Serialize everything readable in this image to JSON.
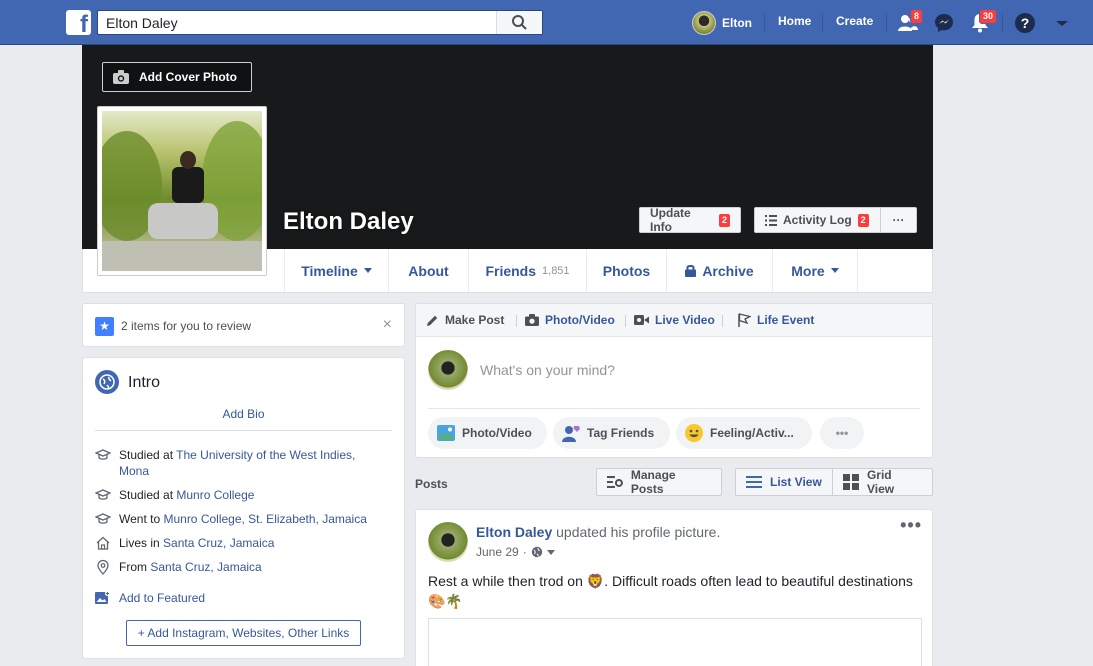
{
  "topbar": {
    "logo": "f",
    "search_value": "Elton Daley",
    "search_placeholder": "Search",
    "user_name": "Elton",
    "home": "Home",
    "create": "Create",
    "friend_requests_badge": "8",
    "notifications_badge": "30"
  },
  "cover": {
    "add_cover_label": "Add Cover Photo",
    "name": "Elton Daley",
    "update_info_label": "Update Info",
    "update_info_count": "2",
    "activity_log_label": "Activity Log",
    "activity_log_count": "2",
    "more_label": "···"
  },
  "profile_nav": {
    "timeline": "Timeline",
    "about": "About",
    "friends": "Friends",
    "friends_count": "1,851",
    "photos": "Photos",
    "archive": "Archive",
    "more": "More"
  },
  "review": {
    "text": "2 items for you to review",
    "close": "×"
  },
  "intro": {
    "title": "Intro",
    "add_bio": "Add Bio",
    "rows": [
      {
        "prefix": "Studied at ",
        "link": "The University of the West Indies, Mona"
      },
      {
        "prefix": "Studied at ",
        "link": "Munro College"
      },
      {
        "prefix": "Went to ",
        "link": "Munro College, St. Elizabeth, Jamaica"
      },
      {
        "prefix": "Lives in ",
        "link": "Santa Cruz, Jamaica"
      },
      {
        "prefix": "From ",
        "link": "Santa Cruz, Jamaica"
      }
    ],
    "add_featured": "Add to Featured",
    "add_links": "+ Add Instagram, Websites, Other Links"
  },
  "composer": {
    "tabs": [
      "Make Post",
      "Photo/Video",
      "Live Video",
      "Life Event"
    ],
    "placeholder": "What's on your mind?",
    "pills": [
      "Photo/Video",
      "Tag Friends",
      "Feeling/Activ...",
      "•••"
    ]
  },
  "posts_header": {
    "label": "Posts",
    "manage": "Manage Posts",
    "list_view": "List View",
    "grid_view": "Grid View"
  },
  "post": {
    "author": "Elton Daley",
    "action": " updated his profile picture.",
    "date": "June 29",
    "more": "•••",
    "text": "Rest a while then trod on 🦁. Difficult roads often lead to beautiful destinations 🎨🌴"
  },
  "colors": {
    "brand_blue": "#4267b2",
    "link_blue": "#365899",
    "badge_red": "#fa3e3e",
    "page_bg": "#e9ebee"
  }
}
